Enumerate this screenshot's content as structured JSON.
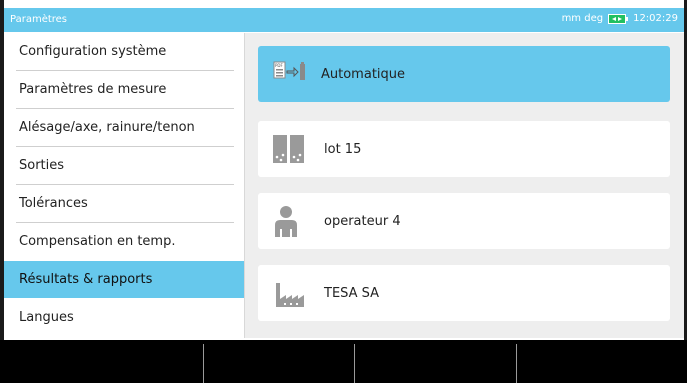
{
  "titlebar": {
    "title": "Paramètres",
    "units": "mm deg",
    "time": "12:02:29"
  },
  "sidebar": {
    "items": [
      {
        "label": "Configuration système",
        "selected": false
      },
      {
        "label": "Paramètres de mesure",
        "selected": false
      },
      {
        "label": "Alésage/axe, rainure/tenon",
        "selected": false
      },
      {
        "label": "Sorties",
        "selected": false
      },
      {
        "label": "Tolérances",
        "selected": false
      },
      {
        "label": "Compensation en temp.",
        "selected": false
      },
      {
        "label": "Résultats & rapports",
        "selected": true
      },
      {
        "label": "Langues",
        "selected": false
      }
    ]
  },
  "cards": [
    {
      "label": "Automatique",
      "icon": "pdf-export-icon",
      "selected": true
    },
    {
      "label": "lot 15",
      "icon": "batch-icon",
      "selected": false
    },
    {
      "label": "operateur 4",
      "icon": "operator-icon",
      "selected": false
    },
    {
      "label": "TESA SA",
      "icon": "factory-icon",
      "selected": false
    }
  ],
  "colors": {
    "accent": "#66c8ec",
    "panel": "#eeeeee",
    "softkey_bar": "#000000",
    "icon_gray": "#9a9a9a"
  }
}
